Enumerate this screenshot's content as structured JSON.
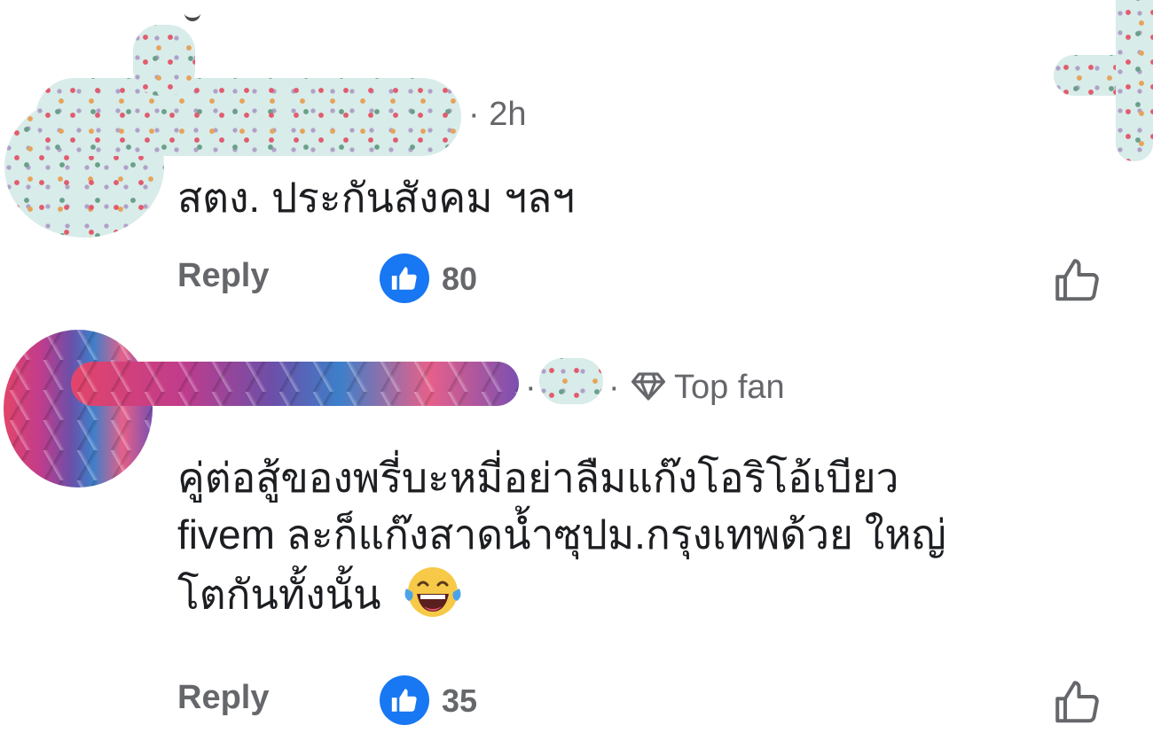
{
  "comments": [
    {
      "time": "2h",
      "text": [
        "สตง. ประกันสังคม ฯลฯ"
      ],
      "reply_label": "Reply",
      "like_count": "80"
    },
    {
      "badge": "Top fan",
      "text": [
        "คู่ต่อสู้ของพรี่บะหมี่อย่าลืมแก๊งโอริโอ้เบียว",
        "fivem ละก็แก๊งสาดน้ำซุปม.กรุงเทพด้วย ใหญ่",
        "โตกันทั้งนั้น"
      ],
      "reply_label": "Reply",
      "like_count": "35"
    }
  ],
  "icons": {
    "like_badge": "thumbs-up-icon",
    "like_button": "thumbs-up-outline-icon",
    "top_fan": "diamond-icon",
    "emoji": "tears-of-joy-emoji"
  },
  "colors": {
    "accent": "#1877f2",
    "meta_text": "#65676b",
    "body_text": "#1c1e21"
  }
}
